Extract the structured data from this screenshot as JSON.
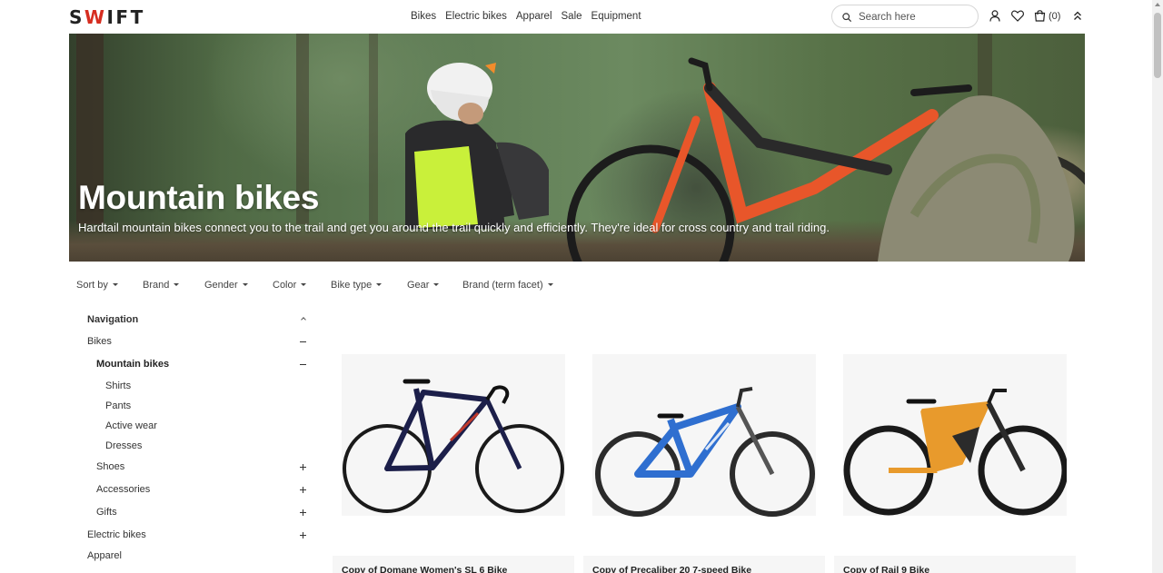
{
  "header": {
    "logo": "SWIFT",
    "nav": [
      "Bikes",
      "Electric bikes",
      "Apparel",
      "Sale",
      "Equipment"
    ],
    "search_placeholder": "Search here",
    "cart_count": "(0)",
    "icons": [
      "search-icon",
      "user-icon",
      "heart-icon",
      "cart-icon",
      "chevrons-up-icon"
    ]
  },
  "hero": {
    "title": "Mountain bikes",
    "subtitle": "Hardtail mountain bikes connect you to the trail and get you around the trail quickly and efficiently. They're ideal for cross country and trail riding."
  },
  "filters": [
    "Sort by",
    "Brand",
    "Gender",
    "Color",
    "Bike type",
    "Gear",
    "Brand (term facet)"
  ],
  "sidebar": {
    "heading": "Navigation",
    "items": [
      {
        "label": "Bikes",
        "control": "minus"
      },
      {
        "label": "Mountain bikes",
        "control": "minus"
      },
      {
        "label": "Shirts",
        "control": "none"
      },
      {
        "label": "Pants",
        "control": "none"
      },
      {
        "label": "Active wear",
        "control": "none"
      },
      {
        "label": "Dresses",
        "control": "none"
      },
      {
        "label": "Shoes",
        "control": "plus"
      },
      {
        "label": "Accessories",
        "control": "plus"
      },
      {
        "label": "Gifts",
        "control": "plus"
      },
      {
        "label": "Electric bikes",
        "control": "plus"
      },
      {
        "label": "Apparel",
        "control": "none"
      }
    ]
  },
  "products": [
    {
      "title": "Copy of Domane Women's SL 6 Bike",
      "color": "#1c1f4a",
      "accent": "#c0392b"
    },
    {
      "title": "Copy of Precaliber 20 7-speed Bike",
      "color": "#2f6fd0",
      "accent": "#dfe8f5"
    },
    {
      "title": "Copy of Rail 9 Bike",
      "color": "#e89a2c",
      "accent": "#2b2b2b"
    }
  ],
  "colors": {
    "accent": "#d62d20",
    "text": "#222222",
    "hero_text": "#ffffff"
  }
}
